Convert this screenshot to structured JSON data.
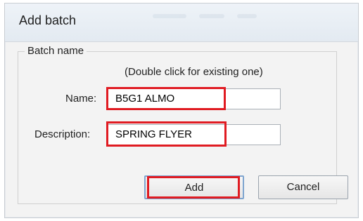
{
  "dialog": {
    "title": "Add batch",
    "group_label": "Batch name",
    "hint": "(Double click for existing one)",
    "name_label": "Name:",
    "name_value": "B5G1 ALMO",
    "description_label": "Description:",
    "description_value": "SPRING FLYER",
    "add_label": "Add",
    "cancel_label": "Cancel"
  },
  "colors": {
    "highlight": "#e01b22",
    "default_button_border": "#7fa5cf"
  }
}
